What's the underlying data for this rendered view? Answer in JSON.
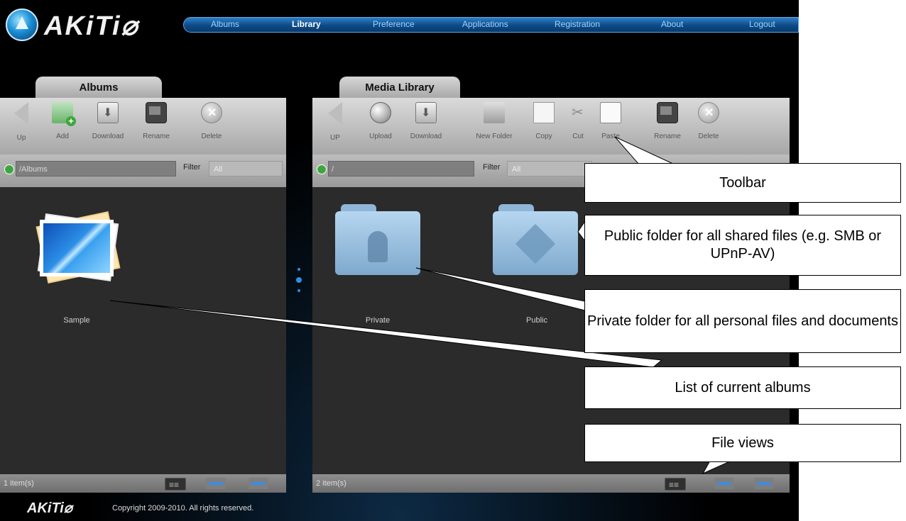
{
  "brand": {
    "name": "AKiTi⌀"
  },
  "nav": {
    "items": [
      {
        "label": "Albums",
        "active": false
      },
      {
        "label": "Library",
        "active": true
      },
      {
        "label": "Preference",
        "active": false
      },
      {
        "label": "Applications",
        "active": false
      },
      {
        "label": "Registration",
        "active": false
      },
      {
        "label": "About",
        "active": false
      },
      {
        "label": "Logout",
        "active": false
      }
    ]
  },
  "albums_panel": {
    "tab": "Albums",
    "toolbar": {
      "up": "Up",
      "add": "Add",
      "download": "Download",
      "rename": "Rename",
      "delete": "Delete"
    },
    "path": "/Albums",
    "filter_label": "Filter",
    "filter_value": "All",
    "items": [
      {
        "label": "Sample"
      }
    ],
    "status": "1 item(s)"
  },
  "library_panel": {
    "tab": "Media Library",
    "toolbar": {
      "up": "UP",
      "upload": "Upload",
      "download": "Download",
      "new_folder": "New Folder",
      "copy": "Copy",
      "cut": "Cut",
      "paste": "Paste",
      "rename": "Rename",
      "delete": "Delete"
    },
    "path": "/",
    "filter_label": "Filter",
    "filter_value": "All",
    "items": [
      {
        "label": "Private"
      },
      {
        "label": "Public"
      }
    ],
    "status": "2 item(s)"
  },
  "footer": {
    "logo": "AKiTi⌀",
    "copyright": "Copyright 2009-2010. All rights reserved."
  },
  "callouts": {
    "toolbar": "Toolbar",
    "public_folder": "Public folder for all shared files (e.g. SMB or UPnP-AV)",
    "private_folder": "Private folder for all personal files and documents",
    "albums_list": "List of current albums",
    "file_views": "File views"
  },
  "colors": {
    "accent": "#2f7fc6",
    "panel_bg": "#2b2b2b",
    "toolbar_bg": "#c4c4c4"
  }
}
